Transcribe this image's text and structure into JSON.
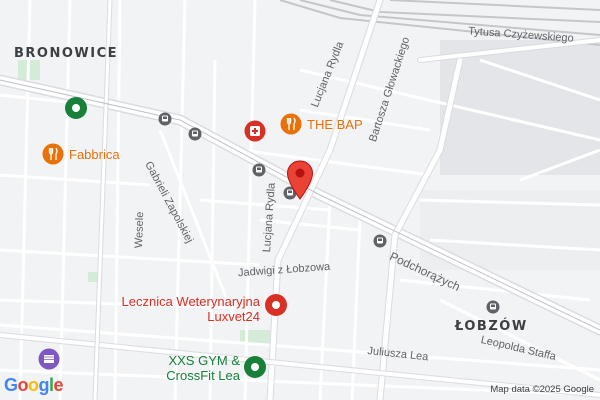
{
  "map": {
    "district_labels": [
      "BRONOWICE",
      "ŁOBZÓW"
    ],
    "street_labels": {
      "tytusa": "Tytusa Czyżewskiego",
      "bartosza": "Bartosza Głowackiego",
      "rydla_top": "Lucjana Rydla",
      "rydla_mid": "Lucjana Rydla",
      "zapolskiej": "Gabrieli Zapolskiej",
      "wesele": "Wesele",
      "jadwigi": "Jadwigi z Łobzowa",
      "podchorazych": "Podchorążych",
      "leopolda": "Leopolda Staffa",
      "juliusza": "Juliusza Lea"
    },
    "pois": {
      "the_bap": {
        "label": "THE BAP",
        "color": "#e8710a",
        "icon": "restaurant-icon"
      },
      "fabbrica": {
        "label": "Fabbrica",
        "color": "#e8710a",
        "icon": "restaurant-icon"
      },
      "lecznica": {
        "label": "Lecznica Weterynaryjna\nLuxvet24",
        "color": "#d93025",
        "icon": "medical-icon"
      },
      "xxs_gym": {
        "label": "XXS GYM &\nCrossFit Lea",
        "color": "#188038",
        "icon": "gym-icon"
      }
    },
    "attribution": "Map data ©2025 Google",
    "logo": "Google",
    "colors": {
      "background": "#f1f3f4",
      "road": "#ffffff",
      "major_road": "#dadce0",
      "rail": "#c4c7c9",
      "park": "#d4ecd7",
      "pin": "#ea4335",
      "transit": "#5f6368",
      "purple_poi": "#7e57c2"
    }
  }
}
